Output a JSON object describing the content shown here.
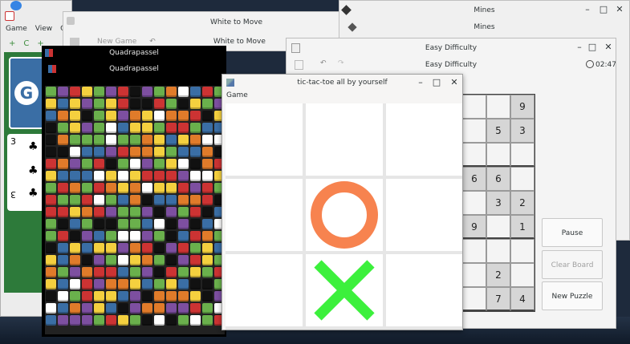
{
  "solitaire": {
    "menu": [
      "Game",
      "View",
      "Co"
    ],
    "tools": [
      "+",
      "C",
      "+"
    ],
    "card": {
      "rank": "3",
      "suit": "♣"
    }
  },
  "chess": {
    "title": "White to Move",
    "header_title": "White to Move",
    "new_game": "New Game"
  },
  "mines": {
    "title": "Mines",
    "header_title": "Mines"
  },
  "sudoku": {
    "title": "Easy Difficulty",
    "header_title": "Easy Difficulty",
    "timer": "02:47",
    "grid": [
      [
        "",
        "",
        "9"
      ],
      [
        "",
        "5",
        "3"
      ],
      [
        "",
        "",
        ""
      ],
      [
        "6",
        "6",
        ""
      ],
      [
        "",
        "3",
        "2"
      ],
      [
        "9",
        "",
        "1"
      ],
      [
        "",
        "",
        ""
      ],
      [
        "",
        "2",
        ""
      ],
      [
        "",
        "7",
        "4"
      ]
    ],
    "buttons": {
      "pause": "Pause",
      "clear": "Clear Board",
      "new_puzzle": "New Puzzle"
    }
  },
  "quadrapassel": {
    "title": "Quadrapassel",
    "header_title": "Quadrapassel",
    "colors": [
      "#cc3333",
      "#f4d03f",
      "#e07b2a",
      "#6ab04c",
      "#7d4fa0",
      "#3a6ea5",
      "#ffffff",
      "#111111"
    ]
  },
  "tictactoe": {
    "title": "tic-tac-toe all by yourself",
    "menu_game": "Game",
    "board": [
      "",
      "",
      "",
      "",
      "O",
      "",
      "",
      "X",
      ""
    ],
    "o_color": "#f7834f",
    "x_color": "#3cf03c"
  }
}
